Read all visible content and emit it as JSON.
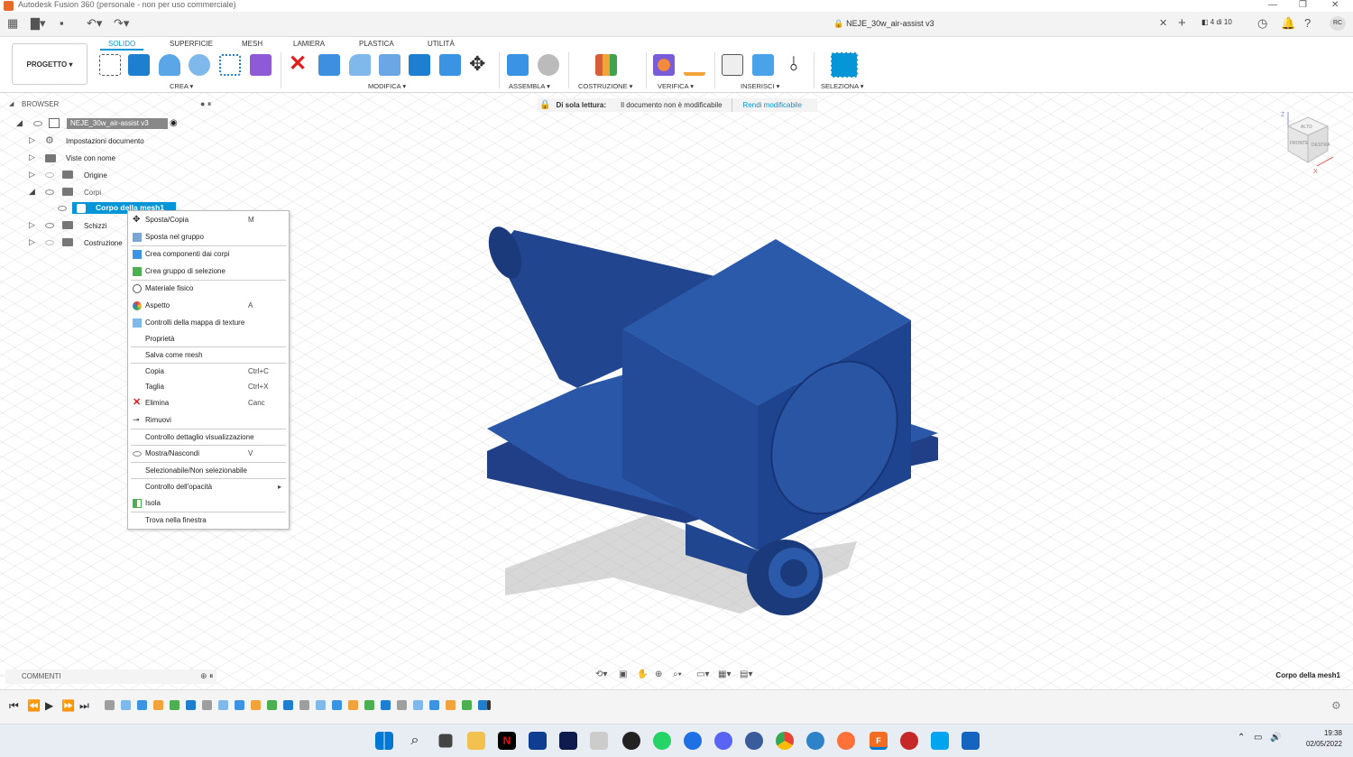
{
  "window": {
    "title": "Autodesk Fusion 360 (personale - non per uso commerciale)",
    "doc_title": "NEJE_30w_air-assist v3",
    "tab_count": "4 di 10",
    "user_initials": "RC"
  },
  "toolbar": {
    "progetto": "PROGETTO ▾",
    "tabs": [
      "SOLIDO",
      "SUPERFICIE",
      "MESH",
      "LAMIERA",
      "PLASTICA",
      "UTILITÀ"
    ],
    "groups": [
      "CREA ▾",
      "MODIFICA ▾",
      "ASSEMBLA ▾",
      "COSTRUZIONE ▾",
      "VERIFICA ▾",
      "INSERISCI ▾",
      "SELEZIONA ▾"
    ]
  },
  "browser": {
    "header": "BROWSER",
    "root": "NEJE_30w_air-assist v3",
    "items": [
      "Impostazioni documento",
      "Viste con nome",
      "Origine",
      "Corpi",
      "Corpo della mesh1",
      "Schizzi",
      "Costruzione"
    ]
  },
  "readonly": {
    "label": "Di sola lettura:",
    "message": "Il documento non è modificabile",
    "action": "Rendi modificabile"
  },
  "context_menu": [
    {
      "label": "Sposta/Copia",
      "shortcut": "M"
    },
    {
      "label": "Sposta nel gruppo",
      "shortcut": ""
    },
    {
      "label": "Crea componenti dai corpi",
      "shortcut": ""
    },
    {
      "label": "Crea gruppo di selezione",
      "shortcut": ""
    },
    {
      "label": "Materiale fisico",
      "shortcut": ""
    },
    {
      "label": "Aspetto",
      "shortcut": "A"
    },
    {
      "label": "Controlli della mappa di texture",
      "shortcut": ""
    },
    {
      "label": "Proprietà",
      "shortcut": ""
    },
    {
      "label": "Salva come mesh",
      "shortcut": ""
    },
    {
      "label": "Copia",
      "shortcut": "Ctrl+C"
    },
    {
      "label": "Taglia",
      "shortcut": "Ctrl+X"
    },
    {
      "label": "Elimina",
      "shortcut": "Canc"
    },
    {
      "label": "Rimuovi",
      "shortcut": ""
    },
    {
      "label": "Controllo dettaglio visualizzazione",
      "shortcut": ""
    },
    {
      "label": "Mostra/Nascondi",
      "shortcut": "V"
    },
    {
      "label": "Selezionabile/Non selezionabile",
      "shortcut": ""
    },
    {
      "label": "Controllo dell'opacità",
      "shortcut": "▸"
    },
    {
      "label": "Isola",
      "shortcut": ""
    },
    {
      "label": "Trova nella finestra",
      "shortcut": ""
    }
  ],
  "viewcube": {
    "front": "FRONTE",
    "right": "DESTRA",
    "top": "ALTO",
    "axis_z": "Z",
    "axis_x": "X"
  },
  "comments": {
    "label": "COMMENTI"
  },
  "status": {
    "selected": "Corpo della mesh1"
  },
  "taskbar": {
    "time": "19:38",
    "date": "02/05/2022"
  },
  "colors": {
    "accent": "#0696d7",
    "model": "#234b97",
    "model_dark": "#183a7e",
    "model_light": "#2c5aaa"
  }
}
